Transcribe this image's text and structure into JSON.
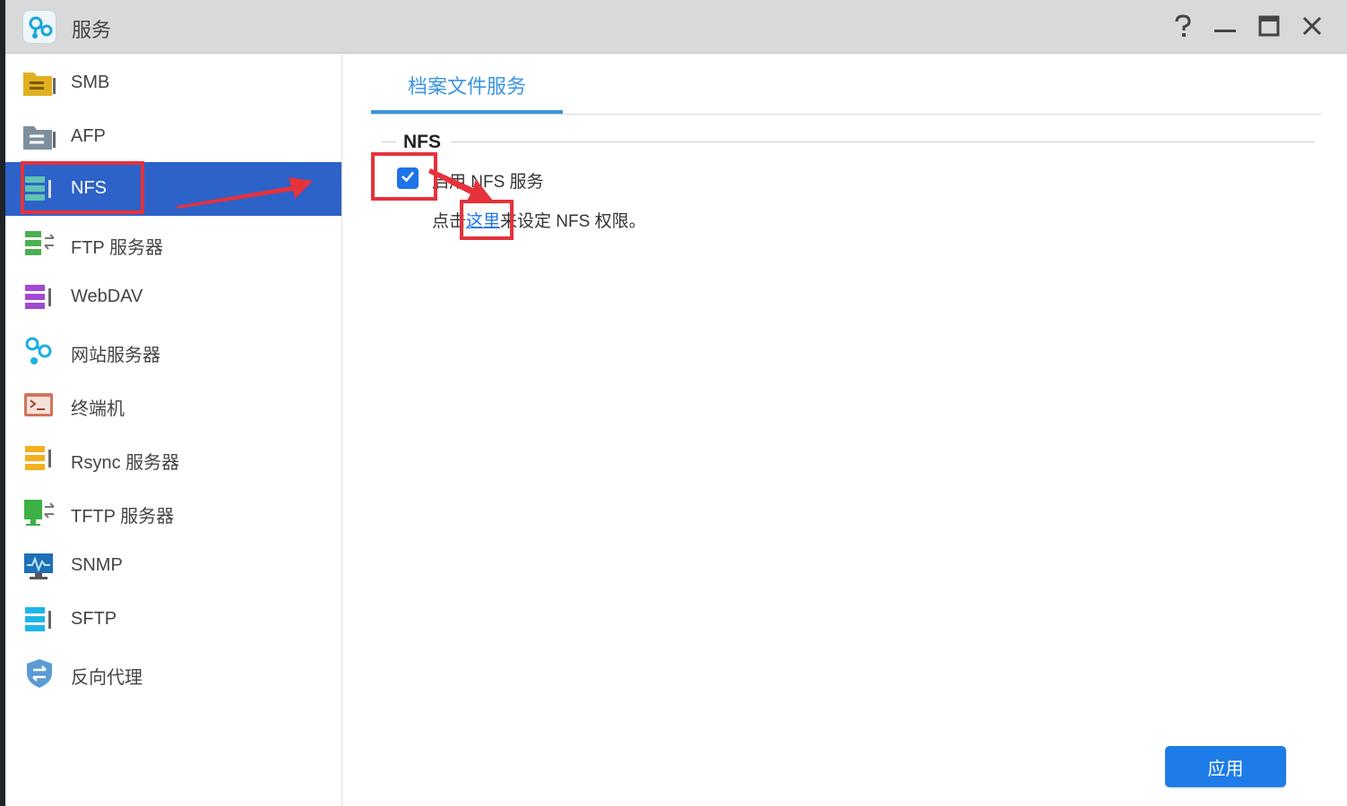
{
  "window": {
    "title": "服务",
    "help_icon": "help-icon",
    "minimize_icon": "minimize-icon",
    "maximize_icon": "maximize-icon",
    "close_icon": "close-icon"
  },
  "sidebar": {
    "active_color": "#2d62c9",
    "items": [
      {
        "label": "SMB",
        "icon": "smb-server-icon",
        "color": "#d9a81a"
      },
      {
        "label": "AFP",
        "icon": "afp-server-icon",
        "color": "#6f8190"
      },
      {
        "label": "NFS",
        "icon": "nfs-server-icon",
        "color": "#4fb8a8"
      },
      {
        "label": "FTP 服务器",
        "icon": "ftp-server-icon",
        "color": "#4caf50"
      },
      {
        "label": "WebDAV",
        "icon": "webdav-server-icon",
        "color": "#a24bd0"
      },
      {
        "label": "网站服务器",
        "icon": "web-server-icon",
        "color": "#1ab0e0"
      },
      {
        "label": "终端机",
        "icon": "terminal-icon",
        "color": "#d2735b"
      },
      {
        "label": "Rsync 服务器",
        "icon": "rsync-server-icon",
        "color": "#f2b01e"
      },
      {
        "label": "TFTP 服务器",
        "icon": "tftp-server-icon",
        "color": "#3cb043"
      },
      {
        "label": "SNMP",
        "icon": "snmp-monitor-icon",
        "color": "#1d6fb8"
      },
      {
        "label": "SFTP",
        "icon": "sftp-server-icon",
        "color": "#1cb6e8"
      },
      {
        "label": "反向代理",
        "icon": "reverse-proxy-shield-icon",
        "color": "#5b9bd5"
      }
    ]
  },
  "main": {
    "tab_label": "档案文件服务",
    "section_title": "NFS",
    "enable_nfs_label": "启用 NFS 服务",
    "enable_nfs_checked": true,
    "perm_prefix": "点击",
    "perm_link": "这里",
    "perm_suffix": "来设定 NFS 权限。",
    "apply_label": "应用",
    "accent": "#3a95e0",
    "button_color": "#1e7ce8"
  },
  "annotations": {
    "highlight_color": "#e5323b"
  }
}
